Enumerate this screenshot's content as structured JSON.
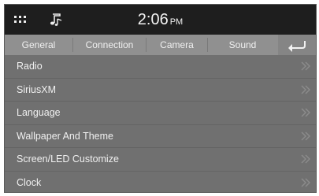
{
  "status_bar": {
    "time": "2:06",
    "ampm": "PM",
    "left_icons": [
      "grid-icon",
      "music-note-icon"
    ]
  },
  "tabs": [
    {
      "label": "General"
    },
    {
      "label": "Connection"
    },
    {
      "label": "Camera"
    },
    {
      "label": "Sound"
    }
  ],
  "back_icon": "back-arrow-icon",
  "menu_items": [
    {
      "label": "Radio"
    },
    {
      "label": "SiriusXM"
    },
    {
      "label": "Language"
    },
    {
      "label": "Wallpaper And Theme"
    },
    {
      "label": "Screen/LED Customize"
    },
    {
      "label": "Clock"
    }
  ],
  "item_icon": "double-chevron-right-icon",
  "colors": {
    "status_bar": "#1e1e1e",
    "tab_bar": "#909090",
    "list_background": "#707070",
    "text": "#f0f0f0"
  }
}
